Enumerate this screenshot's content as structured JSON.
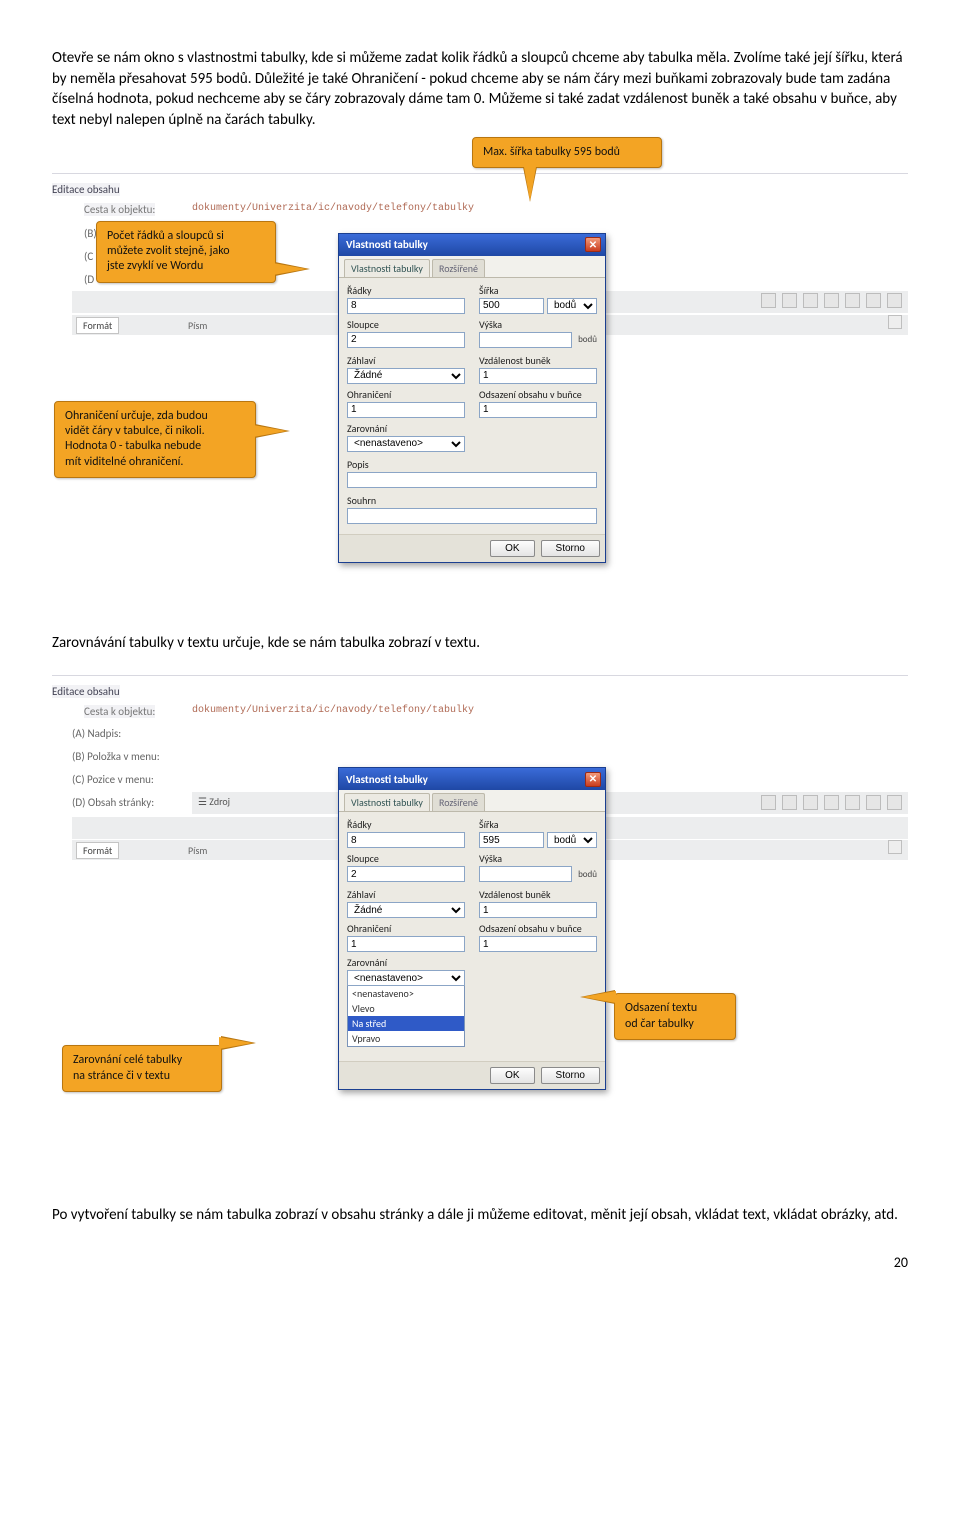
{
  "paragraphs": {
    "intro": "Otevře se nám okno s vlastnostmi tabulky, kde si můžeme zadat kolik řádků a sloupců chceme aby tabulka měla. Zvolíme také její šířku, která by neměla přesahovat 595 bodů. Důležité je také Ohraničení - pokud chceme aby se nám čáry mezi buňkami zobrazovaly bude tam zadána číselná hodnota, pokud nechceme aby se čáry zobrazovaly dáme tam 0. Můžeme si také zadat vzdálenost buněk a také obsahu v buňce, aby text nebyl nalepen úplně na čarách tabulky.",
    "alignpara": "Zarovnávání tabulky v textu určuje, kde se nám tabulka zobrazí v textu.",
    "outro": "Po vytvoření tabulky se nám tabulka zobrazí v obsahu stránky a dále ji můžeme editovat, měnit její obsah, vkládat text, vkládat obrázky, atd."
  },
  "editor": {
    "title": "Editace obsahu",
    "pathlabel": "Cesta k objektu:",
    "path": "dokumenty/Univerzita/ic/navody/telefony/tabulky",
    "labelsShort": [
      "(B)",
      "(C",
      "(D"
    ],
    "labelsLong": [
      "(A) Nadpis:",
      "(B) Položka v menu:",
      "(C) Pozice v menu:",
      "(D) Obsah stránky:"
    ],
    "zdroj": "Zdroj",
    "format": "Formát",
    "pism": "Písm"
  },
  "dialog": {
    "title": "Vlastnosti tabulky",
    "tab_active": "Vlastnosti tabulky",
    "tab_inactive": "Rozšířené",
    "lbl": {
      "radky": "Řádky",
      "sloupce": "Sloupce",
      "sirka": "Šířka",
      "vyska": "Výška",
      "bodu": "bodů",
      "zahlavi": "Záhlaví",
      "ohraniceni": "Ohraničení",
      "zarovnani": "Zarovnání",
      "vzdalenost": "Vzdálenost buněk",
      "odsazeni": "Odsazení obsahu v buňce",
      "popis": "Popis",
      "souhrn": "Souhrn"
    },
    "val1": {
      "radky": "8",
      "sloupce": "2",
      "sirka": "500",
      "vyska": "",
      "bodu_sel": "bodů",
      "zahlavi": "Žádné",
      "ohran": "1",
      "zarov": "<nenastaveno>",
      "vzd": "1",
      "ods": "1"
    },
    "val2": {
      "radky": "8",
      "sloupce": "2",
      "sirka": "595",
      "vyska": "",
      "bodu_sel": "bodů",
      "zahlavi": "Žádné",
      "ohran": "1",
      "vzd": "1",
      "ods": "1"
    },
    "zarov_opts": [
      "<nenastaveno>",
      "Vlevo",
      "Na střed",
      "Vpravo"
    ],
    "zarov_current": "<nenastaveno>",
    "zarov_selected": "Na střed",
    "ok": "OK",
    "storno": "Storno"
  },
  "callouts": {
    "maxwidth": "Max. šířka tabulky 595 bodů",
    "rowcol": "Počet řádků a sloupců si\nmůžete zvolit stejně, jako\njste zvyklí ve Wordu",
    "border": "Ohraničení určuje, zda budou\nvidět čáry v tabulce, či nikoli.\nHodnota 0 - tabulka nebude\nmít viditelné ohraničení.",
    "align": "Zarovnání celé tabulky\nna stránce či v textu",
    "indent": "Odsazení textu\nod čar tabulky"
  },
  "pagenum": "20"
}
